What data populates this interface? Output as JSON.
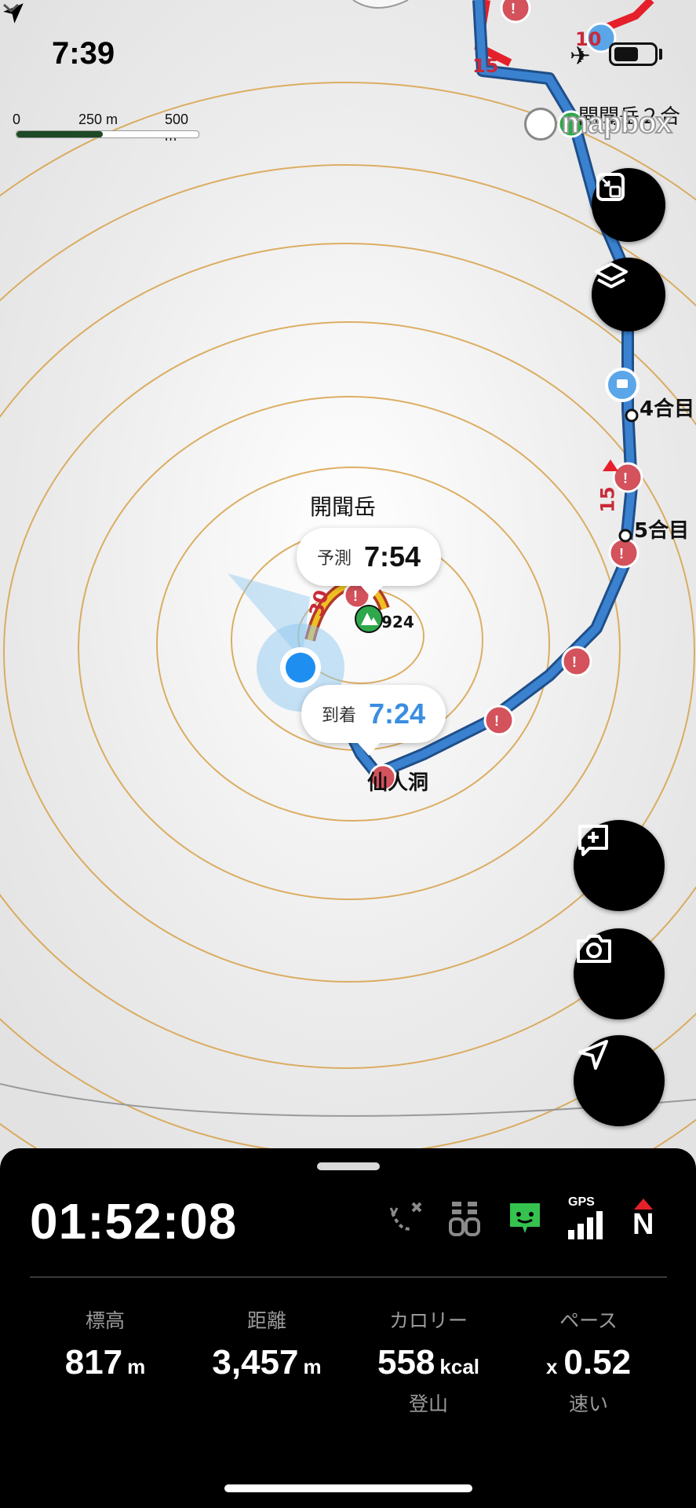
{
  "status_bar": {
    "time": "7:39"
  },
  "map": {
    "scale": {
      "labels": [
        "0",
        "250 m",
        "500 m"
      ]
    },
    "attribution": "mapbox",
    "peak_name": "開聞岳",
    "peak_elevation": "924",
    "route_marks": [
      "15",
      "10",
      "30",
      "15"
    ],
    "waypoints": [
      "開聞岳２合",
      "4合目",
      "5合目",
      "仙人洞"
    ],
    "forecast_bubble": {
      "label": "予測",
      "value": "7:54"
    },
    "arrival_bubble": {
      "label": "到着",
      "value": "7:24"
    },
    "colors": {
      "route": "#3a82d0",
      "route_red": "#e5202a",
      "contour": "#d8a24a",
      "you": "#1f8ef1"
    }
  },
  "buttons": {
    "fit": "fit-icon",
    "layers": "layers-icon",
    "add_memo": "add-memo-icon",
    "camera": "camera-icon",
    "locate": "locate-icon"
  },
  "panel": {
    "elapsed": "01:52:08",
    "icons": [
      "route-off-icon",
      "battery-icon",
      "companion-icon",
      "gps-icon",
      "north-icon"
    ],
    "gps_label": "GPS",
    "north_label": "N",
    "stats": [
      {
        "label": "標高",
        "value": "817",
        "unit": "m"
      },
      {
        "label": "距離",
        "value": "3,457",
        "unit": "m"
      },
      {
        "label": "カロリー",
        "value": "558",
        "unit": "kcal",
        "sub": "登山"
      },
      {
        "label": "ペース",
        "prefix": "x",
        "value": "0.52",
        "sub": "速い"
      }
    ]
  }
}
